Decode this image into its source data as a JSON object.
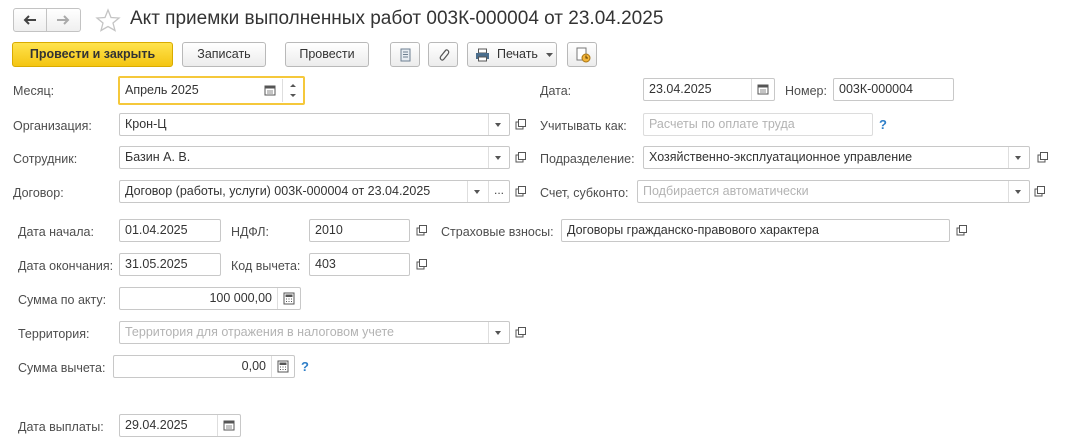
{
  "window": {
    "title": "Акт приемки выполненных работ 003К-000004 от 23.04.2025"
  },
  "toolbar": {
    "post_close_label": "Провести и закрыть",
    "save_label": "Записать",
    "post_label": "Провести",
    "print_label": "Печать"
  },
  "form": {
    "month": {
      "label": "Месяц:",
      "value": "Апрель 2025"
    },
    "date": {
      "label": "Дата:",
      "value": "23.04.2025"
    },
    "number": {
      "label": "Номер:",
      "value": "003К-000004"
    },
    "organization": {
      "label": "Организация:",
      "value": "Крон-Ц"
    },
    "consider_as": {
      "label": "Учитывать как:",
      "placeholder": "Расчеты по оплате труда"
    },
    "employee": {
      "label": "Сотрудник:",
      "value": "Базин А. В."
    },
    "department": {
      "label": "Подразделение:",
      "value": "Хозяйственно-эксплуатационное управление"
    },
    "contract": {
      "label": "Договор:",
      "value": "Договор (работы, услуги) 003К-000004 от 23.04.2025"
    },
    "account": {
      "label": "Счет, субконто:",
      "placeholder": "Подбирается автоматически"
    },
    "start_date": {
      "label": "Дата начала:",
      "value": "01.04.2025"
    },
    "ndfl": {
      "label": "НДФЛ:",
      "value": "2010"
    },
    "insurance": {
      "label": "Страховые взносы:",
      "value": "Договоры гражданско-правового характера"
    },
    "end_date": {
      "label": "Дата окончания:",
      "value": "31.05.2025"
    },
    "deduction_code": {
      "label": "Код вычета:",
      "value": "403"
    },
    "act_sum": {
      "label": "Сумма по акту:",
      "value": "100 000,00"
    },
    "territory": {
      "label": "Территория:",
      "placeholder": "Территория для отражения в налоговом учете"
    },
    "deduction_sum": {
      "label": "Сумма вычета:",
      "value": "0,00"
    },
    "payment_date": {
      "label": "Дата выплаты:",
      "value": "29.04.2025"
    },
    "help_mark": "?"
  }
}
